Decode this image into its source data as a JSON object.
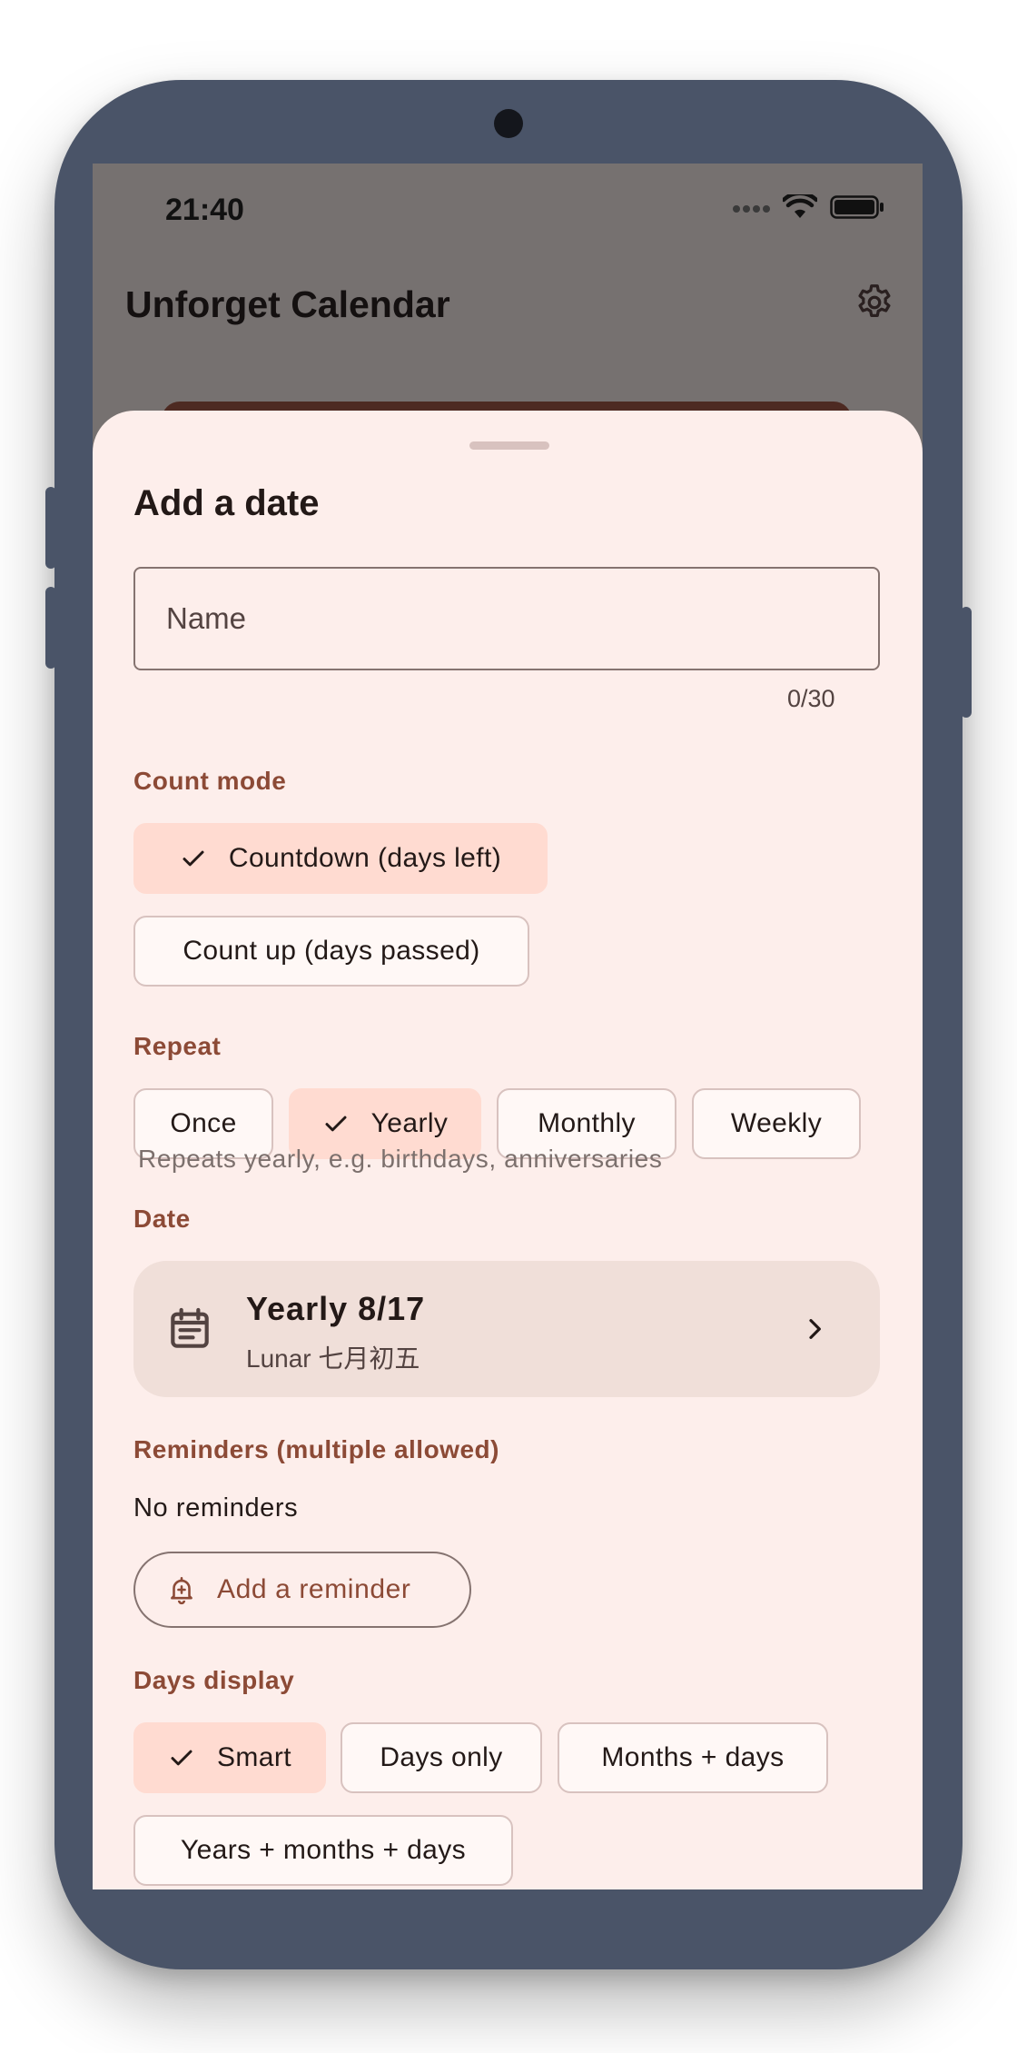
{
  "status_bar": {
    "time": "21:40"
  },
  "app": {
    "title": "Unforget Calendar"
  },
  "sheet": {
    "title": "Add a date",
    "name_field": {
      "placeholder": "Name",
      "value": "",
      "counter": "0/30"
    },
    "count_mode": {
      "label": "Count mode",
      "options": [
        "Countdown (days left)",
        "Count up (days passed)"
      ],
      "selected": "Countdown (days left)"
    },
    "repeat": {
      "label": "Repeat",
      "options": [
        "Once",
        "Yearly",
        "Monthly",
        "Weekly"
      ],
      "selected": "Yearly",
      "helper": "Repeats yearly, e.g. birthdays, anniversaries"
    },
    "date": {
      "label": "Date",
      "main": "Yearly 8/17",
      "sub": "Lunar 七月初五"
    },
    "reminders": {
      "label": "Reminders (multiple allowed)",
      "empty_text": "No reminders",
      "add_label": "Add a reminder"
    },
    "days_display": {
      "label": "Days display",
      "options": [
        "Smart",
        "Days only",
        "Months + days",
        "Years + months + days"
      ],
      "selected": "Smart"
    }
  },
  "colors": {
    "accent": "#8c4a36",
    "chip_selected": "#ffdbd1",
    "sheet_bg": "#fdeeeb",
    "phone_frame": "#4a5468"
  },
  "icons": [
    "gear-icon",
    "check-icon",
    "calendar-icon",
    "chevron-right-icon",
    "bell-plus-icon",
    "wifi-icon",
    "battery-icon",
    "signal-icon"
  ]
}
